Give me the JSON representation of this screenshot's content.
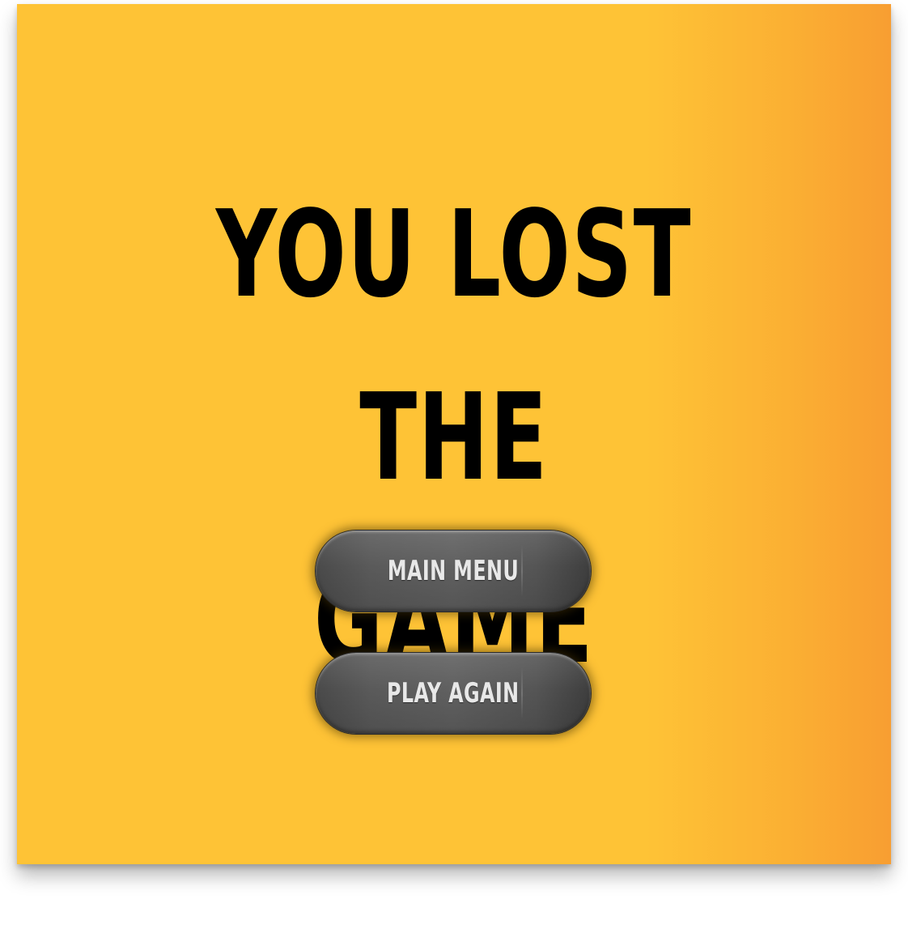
{
  "screen": {
    "name": "game-over",
    "title_line1": "YOU LOST THE",
    "title_line2": "GAME"
  },
  "buttons": {
    "main_menu_label": "MAIN MENU",
    "play_again_label": "PLAY AGAIN"
  },
  "colors": {
    "background": "#fec336",
    "background_edge": "#f89e32",
    "title": "#000000",
    "button_fill": "#5a5a5a",
    "button_text": "#e8e8e8"
  }
}
